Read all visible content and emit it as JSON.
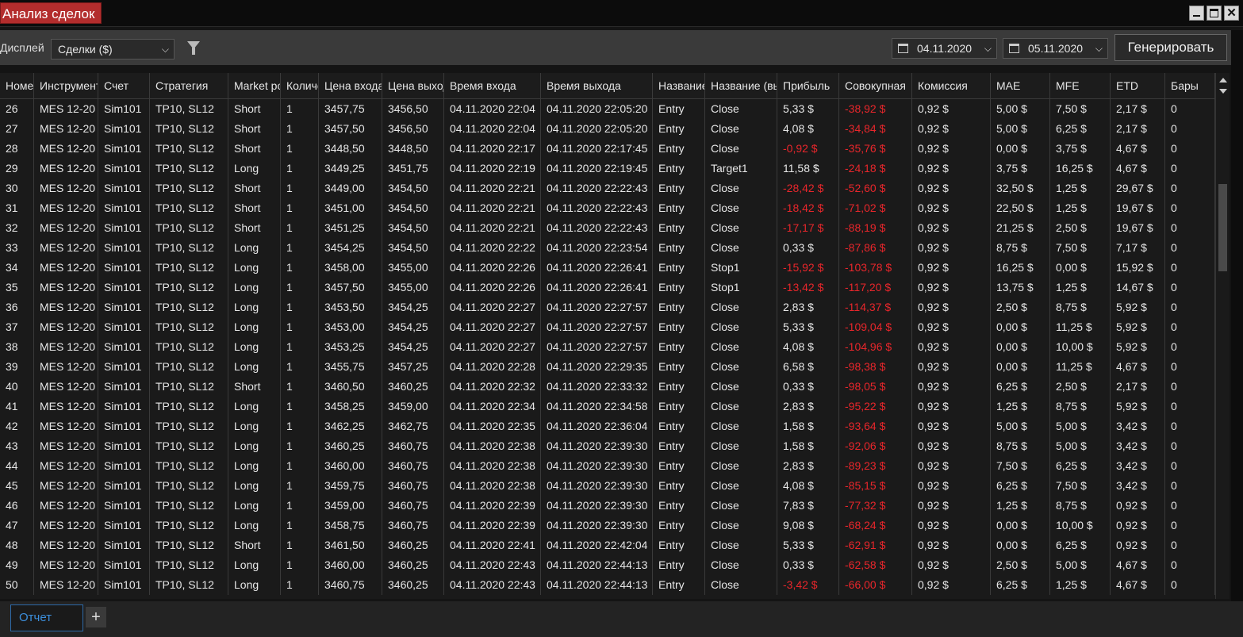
{
  "window": {
    "title": "Анализ сделок",
    "minimize_icon": "minimize-icon",
    "maximize_icon": "maximize-icon",
    "close_icon": "close-icon",
    "close_glyph": "✕"
  },
  "toolbar": {
    "display_label": "Дисплей",
    "display_value": "Сделки ($)",
    "date_from": "04.11.2020",
    "date_to": "05.11.2020",
    "generate_label": "Генерировать",
    "dropdown_glyph": "❯"
  },
  "table": {
    "columns": [
      "Номер",
      "Инструмент",
      "Счет",
      "Стратегия",
      "Market position",
      "Количество",
      "Цена входа",
      "Цена выхода",
      "Время входа",
      "Время выхода",
      "Название входа",
      "Название (выхода)",
      "Прибыль",
      "Совокупная",
      "Комиссия",
      "MAE",
      "MFE",
      "ETD",
      "Бары"
    ],
    "rows": [
      [
        "26",
        "MES 12-20",
        "Sim101",
        "TP10, SL12",
        "Short",
        "1",
        "3457,75",
        "3456,50",
        "04.11.2020 22:04",
        "04.11.2020 22:05:20",
        "Entry",
        "Close",
        "5,33 $",
        "-38,92 $",
        "0,92 $",
        "5,00 $",
        "7,50 $",
        "2,17 $",
        "0"
      ],
      [
        "27",
        "MES 12-20",
        "Sim101",
        "TP10, SL12",
        "Short",
        "1",
        "3457,50",
        "3456,50",
        "04.11.2020 22:04",
        "04.11.2020 22:05:20",
        "Entry",
        "Close",
        "4,08 $",
        "-34,84 $",
        "0,92 $",
        "5,00 $",
        "6,25 $",
        "2,17 $",
        "0"
      ],
      [
        "28",
        "MES 12-20",
        "Sim101",
        "TP10, SL12",
        "Short",
        "1",
        "3448,50",
        "3448,50",
        "04.11.2020 22:17",
        "04.11.2020 22:17:45",
        "Entry",
        "Close",
        "-0,92 $",
        "-35,76 $",
        "0,92 $",
        "0,00 $",
        "3,75 $",
        "4,67 $",
        "0"
      ],
      [
        "29",
        "MES 12-20",
        "Sim101",
        "TP10, SL12",
        "Long",
        "1",
        "3449,25",
        "3451,75",
        "04.11.2020 22:19",
        "04.11.2020 22:19:45",
        "Entry",
        "Target1",
        "11,58 $",
        "-24,18 $",
        "0,92 $",
        "3,75 $",
        "16,25 $",
        "4,67 $",
        "0"
      ],
      [
        "30",
        "MES 12-20",
        "Sim101",
        "TP10, SL12",
        "Short",
        "1",
        "3449,00",
        "3454,50",
        "04.11.2020 22:21",
        "04.11.2020 22:22:43",
        "Entry",
        "Close",
        "-28,42 $",
        "-52,60 $",
        "0,92 $",
        "32,50 $",
        "1,25 $",
        "29,67 $",
        "0"
      ],
      [
        "31",
        "MES 12-20",
        "Sim101",
        "TP10, SL12",
        "Short",
        "1",
        "3451,00",
        "3454,50",
        "04.11.2020 22:21",
        "04.11.2020 22:22:43",
        "Entry",
        "Close",
        "-18,42 $",
        "-71,02 $",
        "0,92 $",
        "22,50 $",
        "1,25 $",
        "19,67 $",
        "0"
      ],
      [
        "32",
        "MES 12-20",
        "Sim101",
        "TP10, SL12",
        "Short",
        "1",
        "3451,25",
        "3454,50",
        "04.11.2020 22:21",
        "04.11.2020 22:22:43",
        "Entry",
        "Close",
        "-17,17 $",
        "-88,19 $",
        "0,92 $",
        "21,25 $",
        "2,50 $",
        "19,67 $",
        "0"
      ],
      [
        "33",
        "MES 12-20",
        "Sim101",
        "TP10, SL12",
        "Long",
        "1",
        "3454,25",
        "3454,50",
        "04.11.2020 22:22",
        "04.11.2020 22:23:54",
        "Entry",
        "Close",
        "0,33 $",
        "-87,86 $",
        "0,92 $",
        "8,75 $",
        "7,50 $",
        "7,17 $",
        "0"
      ],
      [
        "34",
        "MES 12-20",
        "Sim101",
        "TP10, SL12",
        "Long",
        "1",
        "3458,00",
        "3455,00",
        "04.11.2020 22:26",
        "04.11.2020 22:26:41",
        "Entry",
        "Stop1",
        "-15,92 $",
        "-103,78 $",
        "0,92 $",
        "16,25 $",
        "0,00 $",
        "15,92 $",
        "0"
      ],
      [
        "35",
        "MES 12-20",
        "Sim101",
        "TP10, SL12",
        "Long",
        "1",
        "3457,50",
        "3455,00",
        "04.11.2020 22:26",
        "04.11.2020 22:26:41",
        "Entry",
        "Stop1",
        "-13,42 $",
        "-117,20 $",
        "0,92 $",
        "13,75 $",
        "1,25 $",
        "14,67 $",
        "0"
      ],
      [
        "36",
        "MES 12-20",
        "Sim101",
        "TP10, SL12",
        "Long",
        "1",
        "3453,50",
        "3454,25",
        "04.11.2020 22:27",
        "04.11.2020 22:27:57",
        "Entry",
        "Close",
        "2,83 $",
        "-114,37 $",
        "0,92 $",
        "2,50 $",
        "8,75 $",
        "5,92 $",
        "0"
      ],
      [
        "37",
        "MES 12-20",
        "Sim101",
        "TP10, SL12",
        "Long",
        "1",
        "3453,00",
        "3454,25",
        "04.11.2020 22:27",
        "04.11.2020 22:27:57",
        "Entry",
        "Close",
        "5,33 $",
        "-109,04 $",
        "0,92 $",
        "0,00 $",
        "11,25 $",
        "5,92 $",
        "0"
      ],
      [
        "38",
        "MES 12-20",
        "Sim101",
        "TP10, SL12",
        "Long",
        "1",
        "3453,25",
        "3454,25",
        "04.11.2020 22:27",
        "04.11.2020 22:27:57",
        "Entry",
        "Close",
        "4,08 $",
        "-104,96 $",
        "0,92 $",
        "0,00 $",
        "10,00 $",
        "5,92 $",
        "0"
      ],
      [
        "39",
        "MES 12-20",
        "Sim101",
        "TP10, SL12",
        "Long",
        "1",
        "3455,75",
        "3457,25",
        "04.11.2020 22:28",
        "04.11.2020 22:29:35",
        "Entry",
        "Close",
        "6,58 $",
        "-98,38 $",
        "0,92 $",
        "0,00 $",
        "11,25 $",
        "4,67 $",
        "0"
      ],
      [
        "40",
        "MES 12-20",
        "Sim101",
        "TP10, SL12",
        "Short",
        "1",
        "3460,50",
        "3460,25",
        "04.11.2020 22:32",
        "04.11.2020 22:33:32",
        "Entry",
        "Close",
        "0,33 $",
        "-98,05 $",
        "0,92 $",
        "6,25 $",
        "2,50 $",
        "2,17 $",
        "0"
      ],
      [
        "41",
        "MES 12-20",
        "Sim101",
        "TP10, SL12",
        "Long",
        "1",
        "3458,25",
        "3459,00",
        "04.11.2020 22:34",
        "04.11.2020 22:34:58",
        "Entry",
        "Close",
        "2,83 $",
        "-95,22 $",
        "0,92 $",
        "1,25 $",
        "8,75 $",
        "5,92 $",
        "0"
      ],
      [
        "42",
        "MES 12-20",
        "Sim101",
        "TP10, SL12",
        "Long",
        "1",
        "3462,25",
        "3462,75",
        "04.11.2020 22:35",
        "04.11.2020 22:36:04",
        "Entry",
        "Close",
        "1,58 $",
        "-93,64 $",
        "0,92 $",
        "5,00 $",
        "5,00 $",
        "3,42 $",
        "0"
      ],
      [
        "43",
        "MES 12-20",
        "Sim101",
        "TP10, SL12",
        "Long",
        "1",
        "3460,25",
        "3460,75",
        "04.11.2020 22:38",
        "04.11.2020 22:39:30",
        "Entry",
        "Close",
        "1,58 $",
        "-92,06 $",
        "0,92 $",
        "8,75 $",
        "5,00 $",
        "3,42 $",
        "0"
      ],
      [
        "44",
        "MES 12-20",
        "Sim101",
        "TP10, SL12",
        "Long",
        "1",
        "3460,00",
        "3460,75",
        "04.11.2020 22:38",
        "04.11.2020 22:39:30",
        "Entry",
        "Close",
        "2,83 $",
        "-89,23 $",
        "0,92 $",
        "7,50 $",
        "6,25 $",
        "3,42 $",
        "0"
      ],
      [
        "45",
        "MES 12-20",
        "Sim101",
        "TP10, SL12",
        "Long",
        "1",
        "3459,75",
        "3460,75",
        "04.11.2020 22:38",
        "04.11.2020 22:39:30",
        "Entry",
        "Close",
        "4,08 $",
        "-85,15 $",
        "0,92 $",
        "6,25 $",
        "7,50 $",
        "3,42 $",
        "0"
      ],
      [
        "46",
        "MES 12-20",
        "Sim101",
        "TP10, SL12",
        "Long",
        "1",
        "3459,00",
        "3460,75",
        "04.11.2020 22:39",
        "04.11.2020 22:39:30",
        "Entry",
        "Close",
        "7,83 $",
        "-77,32 $",
        "0,92 $",
        "1,25 $",
        "8,75 $",
        "0,92 $",
        "0"
      ],
      [
        "47",
        "MES 12-20",
        "Sim101",
        "TP10, SL12",
        "Long",
        "1",
        "3458,75",
        "3460,75",
        "04.11.2020 22:39",
        "04.11.2020 22:39:30",
        "Entry",
        "Close",
        "9,08 $",
        "-68,24 $",
        "0,92 $",
        "0,00 $",
        "10,00 $",
        "0,92 $",
        "0"
      ],
      [
        "48",
        "MES 12-20",
        "Sim101",
        "TP10, SL12",
        "Short",
        "1",
        "3461,50",
        "3460,25",
        "04.11.2020 22:41",
        "04.11.2020 22:42:04",
        "Entry",
        "Close",
        "5,33 $",
        "-62,91 $",
        "0,92 $",
        "0,00 $",
        "6,25 $",
        "0,92 $",
        "0"
      ],
      [
        "49",
        "MES 12-20",
        "Sim101",
        "TP10, SL12",
        "Long",
        "1",
        "3460,00",
        "3460,25",
        "04.11.2020 22:43",
        "04.11.2020 22:44:13",
        "Entry",
        "Close",
        "0,33 $",
        "-62,58 $",
        "0,92 $",
        "2,50 $",
        "5,00 $",
        "4,67 $",
        "0"
      ],
      [
        "50",
        "MES 12-20",
        "Sim101",
        "TP10, SL12",
        "Long",
        "1",
        "3460,75",
        "3460,25",
        "04.11.2020 22:43",
        "04.11.2020 22:44:13",
        "Entry",
        "Close",
        "-3,42 $",
        "-66,00 $",
        "0,92 $",
        "6,25 $",
        "1,25 $",
        "4,67 $",
        "0"
      ]
    ]
  },
  "tabs": {
    "active_label": "Отчет",
    "add_label": "+"
  },
  "colors": {
    "negative": "#e8262b",
    "title_bg": "#b32d2d",
    "tab_accent": "#3c8fdc"
  }
}
